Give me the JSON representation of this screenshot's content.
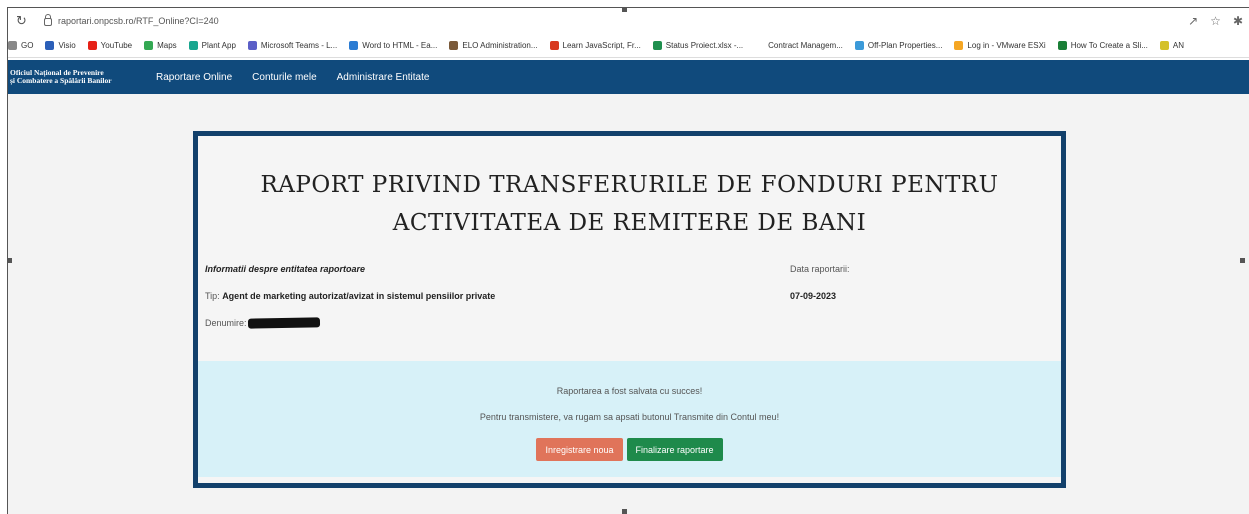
{
  "browser": {
    "url": "raportari.onpcsb.ro/RTF_Online?CI=240",
    "bookmarks": [
      {
        "label": "GO",
        "color": "#888888"
      },
      {
        "label": "Visio",
        "color": "#2b5fb8"
      },
      {
        "label": "YouTube",
        "color": "#e62117"
      },
      {
        "label": "Maps",
        "color": "#34a853"
      },
      {
        "label": "Plant App",
        "color": "#19a68f"
      },
      {
        "label": "Microsoft Teams - L...",
        "color": "#5b5fc7"
      },
      {
        "label": "Word to HTML - Ea...",
        "color": "#2b7cd3"
      },
      {
        "label": "ELO Administration...",
        "color": "#7a5a3a"
      },
      {
        "label": "Learn JavaScript, Fr...",
        "color": "#d8381e"
      },
      {
        "label": "Status Proiect.xlsx -...",
        "color": "#1f8f4e"
      },
      {
        "label": "Contract Managem...",
        "color": "#ffffff"
      },
      {
        "label": "Off-Plan Properties...",
        "color": "#3b9ad9"
      },
      {
        "label": "Log in - VMware ESXi",
        "color": "#f5a623"
      },
      {
        "label": "How To Create a Sli...",
        "color": "#1a7f37"
      },
      {
        "label": "AN",
        "color": "#d4c12a"
      }
    ]
  },
  "nav": {
    "brand_line1": "Oficiul Național de Prevenire",
    "brand_line2": "și Combatere a Spălării Banilor",
    "links": [
      "Raportare Online",
      "Conturile mele",
      "Administrare Entitate"
    ]
  },
  "report": {
    "title": "RAPORT PRIVIND TRANSFERURILE DE FONDURI PENTRU ACTIVITATEA DE REMITERE DE BANI",
    "info_heading": "Informatii despre entitatea raportoare",
    "tip_label": "Tip:",
    "tip_value": "Agent de marketing autorizat/avizat in sistemul pensiilor private",
    "denumire_label": "Denumire:",
    "date_label": "Data raportarii:",
    "date_value": "07-09-2023"
  },
  "alert": {
    "message1": "Raportarea a fost salvata cu succes!",
    "message2": "Pentru transmistere, va rugam sa apsati butonul Transmite din Contul meu!",
    "btn_new": "Inregistrare noua",
    "btn_finalize": "Finalizare raportare"
  },
  "colors": {
    "navbar": "#104a7c",
    "card_border": "#12406b",
    "alert_bg": "#d7f1f8",
    "btn_new": "#e0745a",
    "btn_finalize": "#1e8a4b"
  }
}
